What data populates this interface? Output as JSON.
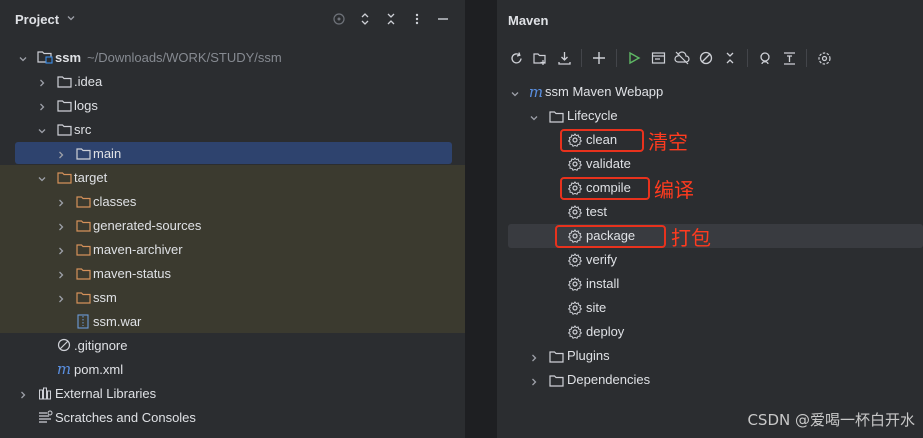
{
  "project_panel": {
    "title": "Project",
    "tree": [
      {
        "label": "ssm",
        "path": "~/Downloads/WORK/STUDY/ssm",
        "icon": "module-folder-icon",
        "expanded": true
      },
      {
        "label": ".idea",
        "icon": "folder-icon",
        "expanded": false
      },
      {
        "label": "logs",
        "icon": "folder-icon",
        "expanded": false
      },
      {
        "label": "src",
        "icon": "folder-icon",
        "expanded": true
      },
      {
        "label": "main",
        "icon": "folder-icon",
        "expanded": false,
        "selected": true
      },
      {
        "label": "target",
        "icon": "folder-orange-icon",
        "expanded": true
      },
      {
        "label": "classes",
        "icon": "folder-orange-icon",
        "expanded": false
      },
      {
        "label": "generated-sources",
        "icon": "folder-orange-icon",
        "expanded": false
      },
      {
        "label": "maven-archiver",
        "icon": "folder-orange-icon",
        "expanded": false
      },
      {
        "label": "maven-status",
        "icon": "folder-orange-icon",
        "expanded": false
      },
      {
        "label": "ssm",
        "icon": "folder-orange-icon",
        "expanded": false
      },
      {
        "label": "ssm.war",
        "icon": "war-file-icon"
      },
      {
        "label": ".gitignore",
        "icon": "ignore-file-icon"
      },
      {
        "label": "pom.xml",
        "icon": "maven-icon"
      },
      {
        "label": "External Libraries",
        "icon": "library-icon",
        "expanded": false
      },
      {
        "label": "Scratches and Consoles",
        "icon": "scratches-icon"
      }
    ]
  },
  "maven_panel": {
    "title": "Maven",
    "toolbar_icons": [
      "reload-icon",
      "add-folder-icon",
      "download-icon",
      "plus-icon",
      "run-icon",
      "execute-goal-icon",
      "offline-icon",
      "skip-tests-icon",
      "collapse-icon",
      "analyze-icon",
      "show-dependencies-icon",
      "settings-icon"
    ],
    "project": "ssm Maven Webapp",
    "lifecycle": "Lifecycle",
    "goals": [
      "clean",
      "validate",
      "compile",
      "test",
      "package",
      "verify",
      "install",
      "site",
      "deploy"
    ],
    "plugins": "Plugins",
    "dependencies": "Dependencies"
  },
  "annotations": {
    "clean": "清空",
    "compile": "编译",
    "package": "打包",
    "color": "#e8321d"
  },
  "watermark": "CSDN @爱喝一杯白开水"
}
